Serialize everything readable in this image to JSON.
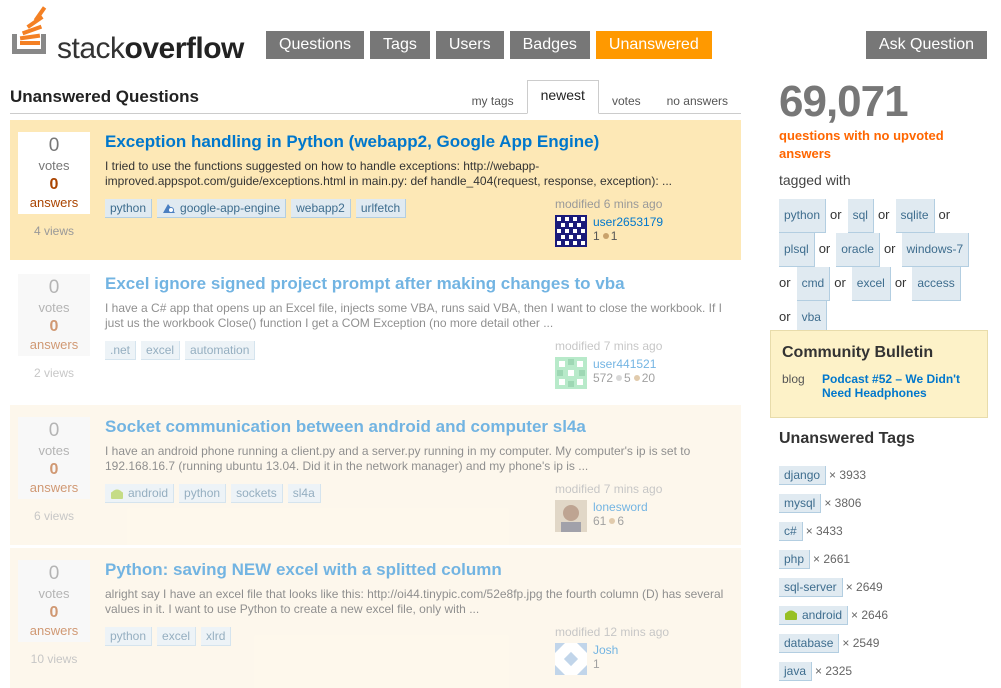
{
  "brand": {
    "prefix": "stack",
    "bold": "overflow"
  },
  "nav": {
    "items": [
      {
        "label": "Questions"
      },
      {
        "label": "Tags"
      },
      {
        "label": "Users"
      },
      {
        "label": "Badges"
      },
      {
        "label": "Unanswered",
        "active": true
      }
    ],
    "ask_label": "Ask Question"
  },
  "page": {
    "title": "Unanswered Questions",
    "tabs": [
      {
        "label": "my tags"
      },
      {
        "label": "newest",
        "active": true
      },
      {
        "label": "votes"
      },
      {
        "label": "no answers"
      }
    ]
  },
  "questions": [
    {
      "votes": "0",
      "votes_label": "votes",
      "answers": "0",
      "answers_label": "answers",
      "views": "4 views",
      "title": "Exception handling in Python (webapp2, Google App Engine)",
      "excerpt": "I tried to use the functions suggested on how to handle exceptions: http://webapp-improved.appspot.com/guide/exceptions.html in main.py: def handle_404(request, response, exception): ...",
      "tags": [
        "python",
        "google-app-engine",
        "webapp2",
        "urlfetch"
      ],
      "modified": "modified 6 mins ago",
      "user": "user2653179",
      "rep": "1",
      "bronze": "1"
    },
    {
      "votes": "0",
      "votes_label": "votes",
      "answers": "0",
      "answers_label": "answers",
      "views": "2 views",
      "title": "Excel ignore signed project prompt after making changes to vba",
      "excerpt": "I have a C# app that opens up an Excel file, injects some VBA, runs said VBA, then I want to close the workbook. If I just us the workbook Close() function I get a COM Exception (no more detail other ...",
      "tags": [
        ".net",
        "excel",
        "automation"
      ],
      "modified": "modified 7 mins ago",
      "user": "user441521",
      "rep": "572",
      "silver": "5",
      "bronze": "20"
    },
    {
      "votes": "0",
      "votes_label": "votes",
      "answers": "0",
      "answers_label": "answers",
      "views": "6 views",
      "title": "Socket communication between android and computer sl4a",
      "excerpt": "I have an android phone running a client.py and a server.py running in my computer. My computer's ip is set to 192.168.16.7 (running ubuntu 13.04. Did it in the network manager) and my phone's ip is ...",
      "tags": [
        "android",
        "python",
        "sockets",
        "sl4a"
      ],
      "modified": "modified 7 mins ago",
      "user": "lonesword",
      "rep": "61",
      "bronze": "6"
    },
    {
      "votes": "0",
      "votes_label": "votes",
      "answers": "0",
      "answers_label": "answers",
      "views": "10 views",
      "title": "Python: saving NEW excel with a splitted column",
      "excerpt": "alright say I have an excel file that looks like this: http://oi44.tinypic.com/52e8fp.jpg the fourth column (D) has several values in it. I want to use Python to create a new excel file, only with ...",
      "tags": [
        "python",
        "excel",
        "xlrd"
      ],
      "modified": "modified 12 mins ago",
      "user": "Josh",
      "rep": "1"
    }
  ],
  "sidebar": {
    "count": "69,071",
    "count_sub": "questions with no upvoted answers",
    "tagged_with": "tagged with",
    "or": "or",
    "tags": [
      "python",
      "sql",
      "sqlite",
      "plsql",
      "oracle",
      "windows-7",
      "cmd",
      "excel",
      "access",
      "vba"
    ],
    "bulletin": {
      "title": "Community Bulletin",
      "kind": "blog",
      "link": "Podcast #52 – We Didn't Need Headphones"
    },
    "unanswered_tags_title": "Unanswered Tags",
    "unanswered_tags": [
      {
        "name": "django",
        "count": "× 3933"
      },
      {
        "name": "mysql",
        "count": "× 3806"
      },
      {
        "name": "c#",
        "count": "× 3433"
      },
      {
        "name": "php",
        "count": "× 2661"
      },
      {
        "name": "sql-server",
        "count": "× 2649"
      },
      {
        "name": "android",
        "count": "× 2646"
      },
      {
        "name": "database",
        "count": "× 2549"
      },
      {
        "name": "java",
        "count": "× 2325"
      }
    ]
  },
  "colors": {
    "accent": "#ff9900",
    "link": "#0077cc",
    "nav": "#777777",
    "highlight": "#fde8b6"
  }
}
